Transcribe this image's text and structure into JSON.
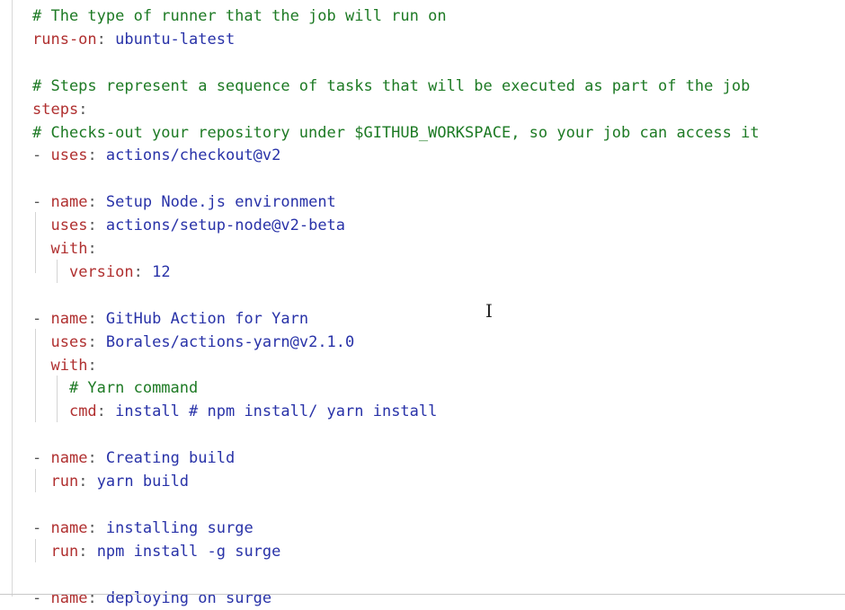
{
  "editor": {
    "lines": [
      {
        "parts": [
          {
            "t": "# The type of runner that the job will run on",
            "c": "c"
          }
        ]
      },
      {
        "parts": [
          {
            "t": "runs-on",
            "c": "k"
          },
          {
            "t": ": ",
            "c": "d"
          },
          {
            "t": "ubuntu-latest",
            "c": "v"
          }
        ]
      },
      {
        "parts": []
      },
      {
        "parts": [
          {
            "t": "# Steps represent a sequence of tasks that will be executed as part of the job",
            "c": "c"
          }
        ]
      },
      {
        "parts": [
          {
            "t": "steps",
            "c": "k"
          },
          {
            "t": ":",
            "c": "d"
          }
        ]
      },
      {
        "parts": [
          {
            "t": "# Checks-out your repository under $GITHUB_WORKSPACE, so your job can access it",
            "c": "c"
          }
        ]
      },
      {
        "parts": [
          {
            "t": "- ",
            "c": "d"
          },
          {
            "t": "uses",
            "c": "k"
          },
          {
            "t": ": ",
            "c": "d"
          },
          {
            "t": "actions/checkout@v2",
            "c": "v"
          }
        ]
      },
      {
        "parts": []
      },
      {
        "parts": [
          {
            "t": "- ",
            "c": "d"
          },
          {
            "t": "name",
            "c": "k"
          },
          {
            "t": ": ",
            "c": "d"
          },
          {
            "t": "Setup Node.js environment",
            "c": "v"
          }
        ]
      },
      {
        "parts": [
          {
            "t": "  ",
            "c": "d"
          },
          {
            "t": "uses",
            "c": "k"
          },
          {
            "t": ": ",
            "c": "d"
          },
          {
            "t": "actions/setup-node@v2-beta",
            "c": "v"
          }
        ]
      },
      {
        "parts": [
          {
            "t": "  ",
            "c": "d"
          },
          {
            "t": "with",
            "c": "k"
          },
          {
            "t": ":",
            "c": "d"
          }
        ]
      },
      {
        "parts": [
          {
            "t": "    ",
            "c": "d"
          },
          {
            "t": "version",
            "c": "k"
          },
          {
            "t": ": ",
            "c": "d"
          },
          {
            "t": "12",
            "c": "v"
          }
        ]
      },
      {
        "parts": []
      },
      {
        "parts": [
          {
            "t": "- ",
            "c": "d"
          },
          {
            "t": "name",
            "c": "k"
          },
          {
            "t": ": ",
            "c": "d"
          },
          {
            "t": "GitHub Action for Yarn",
            "c": "v"
          }
        ]
      },
      {
        "parts": [
          {
            "t": "  ",
            "c": "d"
          },
          {
            "t": "uses",
            "c": "k"
          },
          {
            "t": ": ",
            "c": "d"
          },
          {
            "t": "Borales/actions-yarn@v2.1.0",
            "c": "v"
          }
        ]
      },
      {
        "parts": [
          {
            "t": "  ",
            "c": "d"
          },
          {
            "t": "with",
            "c": "k"
          },
          {
            "t": ":",
            "c": "d"
          }
        ]
      },
      {
        "parts": [
          {
            "t": "    ",
            "c": "d"
          },
          {
            "t": "# Yarn command",
            "c": "c"
          }
        ]
      },
      {
        "parts": [
          {
            "t": "    ",
            "c": "d"
          },
          {
            "t": "cmd",
            "c": "k"
          },
          {
            "t": ": ",
            "c": "d"
          },
          {
            "t": "install # npm install/ yarn install",
            "c": "v"
          }
        ]
      },
      {
        "parts": []
      },
      {
        "parts": [
          {
            "t": "- ",
            "c": "d"
          },
          {
            "t": "name",
            "c": "k"
          },
          {
            "t": ": ",
            "c": "d"
          },
          {
            "t": "Creating build",
            "c": "v"
          }
        ]
      },
      {
        "parts": [
          {
            "t": "  ",
            "c": "d"
          },
          {
            "t": "run",
            "c": "k"
          },
          {
            "t": ": ",
            "c": "d"
          },
          {
            "t": "yarn build",
            "c": "v"
          }
        ]
      },
      {
        "parts": []
      },
      {
        "parts": [
          {
            "t": "- ",
            "c": "d"
          },
          {
            "t": "name",
            "c": "k"
          },
          {
            "t": ": ",
            "c": "d"
          },
          {
            "t": "installing surge",
            "c": "v"
          }
        ]
      },
      {
        "parts": [
          {
            "t": "  ",
            "c": "d"
          },
          {
            "t": "run",
            "c": "k"
          },
          {
            "t": ": ",
            "c": "d"
          },
          {
            "t": "npm install -g surge",
            "c": "v"
          }
        ]
      },
      {
        "parts": []
      },
      {
        "parts": [
          {
            "t": "- ",
            "c": "d"
          },
          {
            "t": "name",
            "c": "k"
          },
          {
            "t": ": ",
            "c": "d"
          },
          {
            "t": "deploying on surge",
            "c": "v"
          }
        ]
      }
    ]
  },
  "cursor": {
    "glyph": "I"
  }
}
